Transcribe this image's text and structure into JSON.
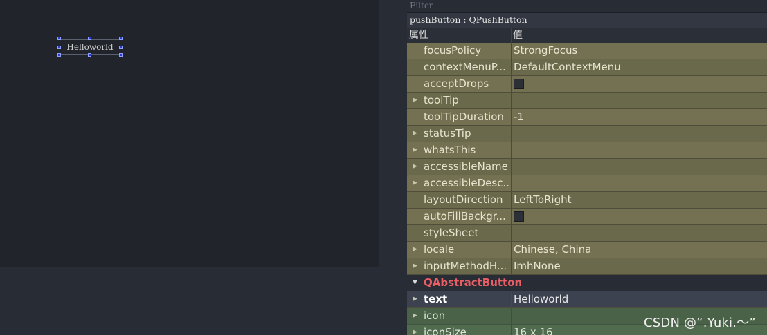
{
  "form": {
    "button_text": "Helloworld"
  },
  "property_editor": {
    "filter_placeholder": "Filter",
    "object_title": "pushButton : QPushButton",
    "header": {
      "property": "属性",
      "value": "值"
    },
    "rows": [
      {
        "name": "focusPolicy",
        "value": "StrongFocus",
        "expandable": false
      },
      {
        "name": "contextMenuP...",
        "value": "DefaultContextMenu",
        "expandable": false
      },
      {
        "name": "acceptDrops",
        "value": "",
        "checkbox": true,
        "expandable": false
      },
      {
        "name": "toolTip",
        "value": "",
        "expandable": true
      },
      {
        "name": "toolTipDuration",
        "value": "-1",
        "expandable": false
      },
      {
        "name": "statusTip",
        "value": "",
        "expandable": true
      },
      {
        "name": "whatsThis",
        "value": "",
        "expandable": true
      },
      {
        "name": "accessibleName",
        "value": "",
        "expandable": true
      },
      {
        "name": "accessibleDesc...",
        "value": "",
        "expandable": true
      },
      {
        "name": "layoutDirection",
        "value": "LeftToRight",
        "expandable": false
      },
      {
        "name": "autoFillBackgr...",
        "value": "",
        "checkbox": true,
        "expandable": false
      },
      {
        "name": "styleSheet",
        "value": "",
        "expandable": false
      },
      {
        "name": "locale",
        "value": "Chinese, China",
        "expandable": true
      },
      {
        "name": "inputMethodH...",
        "value": "ImhNone",
        "expandable": true
      }
    ],
    "group": {
      "name": "QAbstractButton"
    },
    "group_rows": [
      {
        "name": "text",
        "value": "Helloworld",
        "expandable": true
      },
      {
        "name": "icon",
        "value": "",
        "expandable": true
      },
      {
        "name": "iconSize",
        "value": "16 x 16",
        "expandable": true
      }
    ]
  },
  "watermark": "CSDN @“.Yuki.～”",
  "colors": {
    "accent_group": "#ec5e66",
    "olive_row": "#747152",
    "green_row": "#516b4f",
    "background": "#282c34"
  },
  "icons": [
    "expand-arrow-icon",
    "collapse-arrow-icon"
  ]
}
